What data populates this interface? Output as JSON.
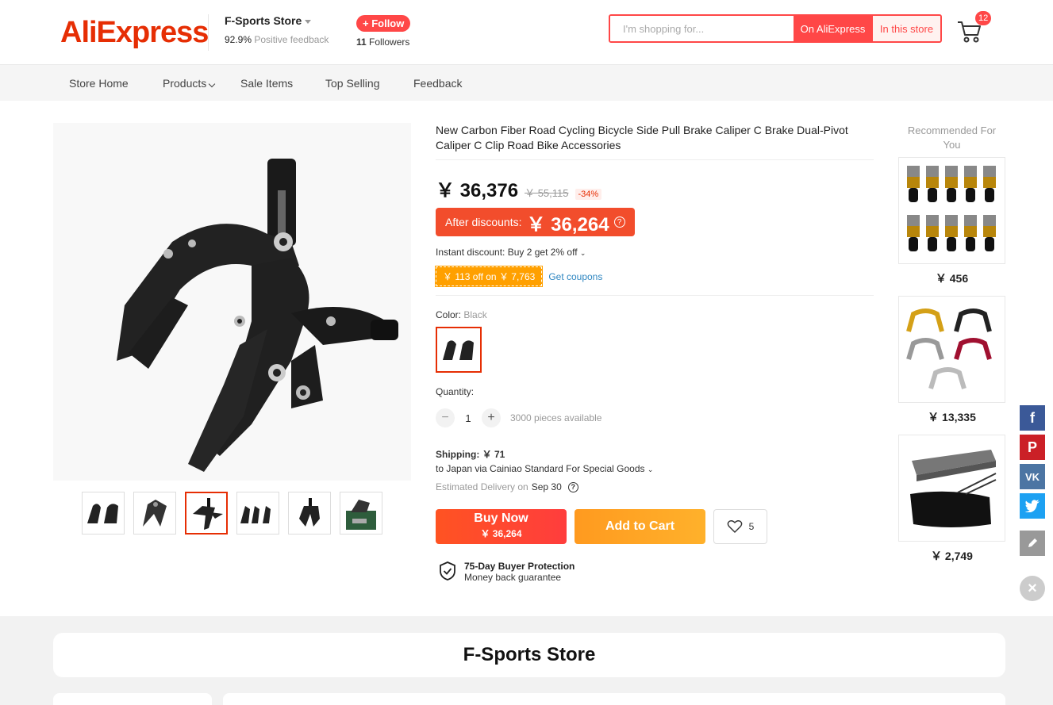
{
  "header": {
    "logo": "AliExpress",
    "store_name": "F-Sports Store",
    "feedback_pct": "92.9%",
    "feedback_label": "Positive feedback",
    "follow_label": "+ Follow",
    "followers_count": "11",
    "followers_label": "Followers",
    "search_placeholder": "I'm shopping for...",
    "search_on_ali": "On AliExpress",
    "search_in_store": "In this store",
    "cart_count": "12"
  },
  "nav": {
    "items": [
      "Store Home",
      "Products",
      "Sale Items",
      "Top Selling",
      "Feedback"
    ]
  },
  "product": {
    "title": "New Carbon Fiber Road Cycling Bicycle Side Pull Brake Caliper C Brake Dual-Pivot Caliper C Clip Road Bike Accessories",
    "price": "￥ 36,376",
    "price_old": "￥ 55,115",
    "discount": "-34%",
    "after_label": "After discounts:",
    "after_price": "￥ 36,264",
    "instant_discount": "Instant discount: Buy 2 get 2% off",
    "coupon": "￥ 113 off on ￥ 7,763",
    "get_coupons": "Get coupons",
    "color_label": "Color:",
    "color_value": "Black",
    "quantity_label": "Quantity:",
    "quantity": "1",
    "available": "3000 pieces available",
    "shipping_label": "Shipping:",
    "shipping_price": "￥ 71",
    "shipping_via": "to Japan via Cainiao Standard For Special Goods",
    "delivery_label": "Estimated Delivery on",
    "delivery_date": "Sep 30",
    "buy_now": "Buy Now",
    "buy_now_price": "￥ 36,264",
    "add_to_cart": "Add to Cart",
    "wishlist_count": "5",
    "protection_title": "75-Day Buyer Protection",
    "protection_sub": "Money back guarantee"
  },
  "recommended": {
    "title": "Recommended For You",
    "items": [
      {
        "price": "￥ 456"
      },
      {
        "price": "￥ 13,335"
      },
      {
        "price": "￥ 2,749"
      }
    ]
  },
  "footer": {
    "store_banner": "F-Sports Store"
  },
  "colors": {
    "brand": "#e62e04",
    "accent": "#ff4747",
    "orange": "#ffa000"
  }
}
